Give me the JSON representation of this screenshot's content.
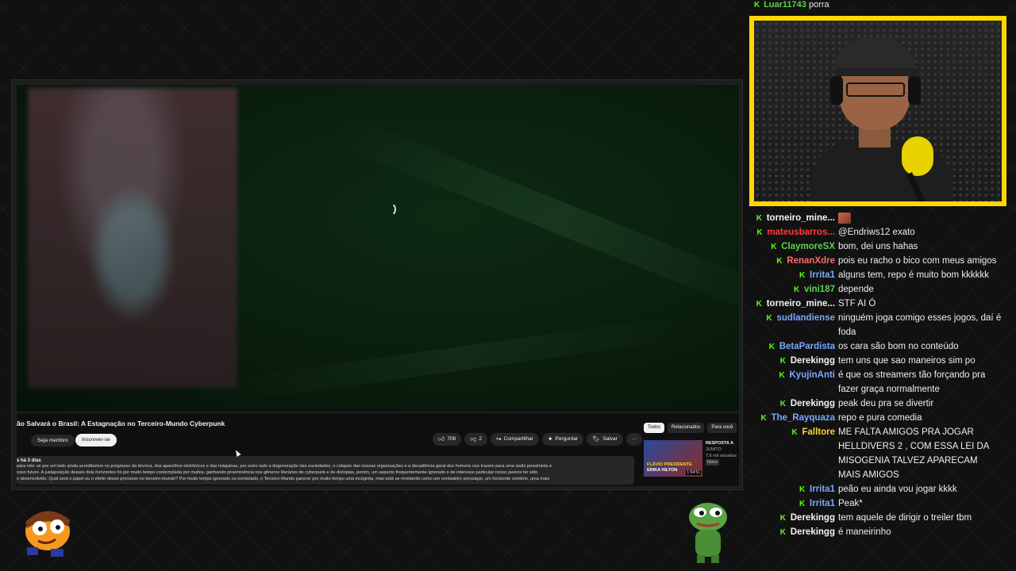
{
  "video": {
    "title": "ão Salvará o Brasil: A Estagnação no Terceiro-Mundo Cyberpunk",
    "member_label": "Seja membro",
    "subscribe_label": "Inscrever-se",
    "like_count": "708",
    "dislike_count": "2",
    "share_label": "Compartilhar",
    "ask_label": "Perguntar",
    "save_label": "Salvar",
    "more_label": "···",
    "meta": "s  há 3 dias",
    "description_lines": [
      "para nós: se por um lado ainda acreditamos no progresso da técnica, dos aparelhos eletrônicos e das máquinas, por outro lado a degeneração das sociedades, o colapso das nossas organizações e a decadência geral dos homens nos trazem para uma visão pessimista e",
      "osso futuro. A justaposição desses dois horizontes foi por muito tempo contemplada por muitos, ganhando proeminência nos gêneros literários de cyberpunk e de distopias, porém, um aspecto frequentemente ignorado e de interesse particular nosso parece ter sido",
      "o desenvolvido: Qual será o papel ou o efeito desse processo no terceiro-mundo? Por muito tempo ignorado ou esmiolado, o Terceiro-Mundo parecer por muito tempo uma incógnita, mas está se revelando como um verdadeiro presságio, um horizonte sombrio, uma       mais"
    ]
  },
  "sidebar_chips": [
    "Todos",
    "Relacionados",
    "Para você"
  ],
  "recommendation": {
    "thumb_line1": "FLÁVIO PRESIDENTE",
    "thumb_line2": "ERIKA HILTON",
    "duration": "1:54:51",
    "title": "RESPOSTA A",
    "channel": "JUNITO",
    "views": "7,6 mil visualiza",
    "badge": "Novo"
  },
  "chat_top": {
    "user": "Luar11743",
    "text": "porra"
  },
  "chat": [
    {
      "user": "torneiro_mine...",
      "color": "#f5f5f5",
      "text": "",
      "emote": true
    },
    {
      "user": "mateusbarros...",
      "color": "#ff3b3b",
      "text": "@Endriws12 exato"
    },
    {
      "user": "ClaymoreSX",
      "color": "#5bd24a",
      "text": "bom, dei uns hahas"
    },
    {
      "user": "RenanXdre",
      "color": "#ff6b6b",
      "text": "pois eu racho o bico com meus amigos"
    },
    {
      "user": "Irrita1",
      "color": "#7aa7ff",
      "text": "alguns tem, repo é muito bom kkkkkk"
    },
    {
      "user": "vini187",
      "color": "#5bd24a",
      "text": "depende"
    },
    {
      "user": "torneiro_mine...",
      "color": "#f5f5f5",
      "text": "STF AI Ó"
    },
    {
      "user": "sudlandiense",
      "color": "#7aa7ff",
      "text": "ninguém joga comigo esses jogos, daí é foda"
    },
    {
      "user": "BetaPardista",
      "color": "#7aa7ff",
      "text": "os cara são bom no conteúdo"
    },
    {
      "user": "Derekingg",
      "color": "#f5f5f5",
      "text": "tem uns que sao maneiros sim po"
    },
    {
      "user": "KyujinAnti",
      "color": "#7aa7ff",
      "text": "é que os streamers tão forçando pra fazer graça normalmente"
    },
    {
      "user": "Derekingg",
      "color": "#f5f5f5",
      "text": "peak deu pra se divertir"
    },
    {
      "user": "The_Rayquaza",
      "color": "#7aa7ff",
      "text": "repo e pura comedia"
    },
    {
      "user": "Falltore",
      "color": "#ffd23a",
      "text": "ME FALTA AMIGOS PRA JOGAR HELLDIVERS 2 , COM ESSA LEI DA MISOGENIA TALVEZ APARECAM MAIS AMIGOS"
    },
    {
      "user": "Irrita1",
      "color": "#7aa7ff",
      "text": "peão eu ainda vou jogar kkkk"
    },
    {
      "user": "Irrita1",
      "color": "#7aa7ff",
      "text": "Peak*"
    },
    {
      "user": "Derekingg",
      "color": "#f5f5f5",
      "text": "tem aquele de dirigir o treiler tbm"
    },
    {
      "user": "Derekingg",
      "color": "#f5f5f5",
      "text": "é maneirinho"
    }
  ],
  "colors": {
    "webcam_border": "#ffd800",
    "kick_green": "#53fc18"
  }
}
